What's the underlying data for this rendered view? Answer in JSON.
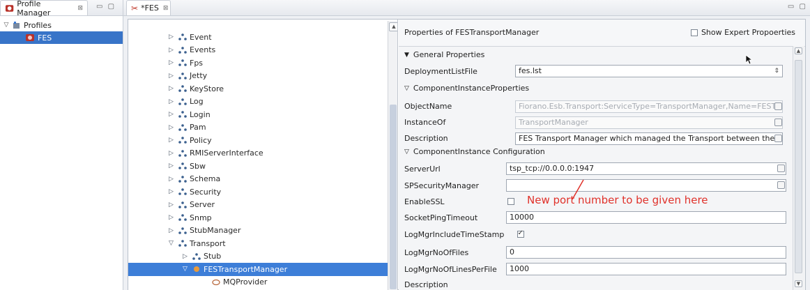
{
  "left_panel": {
    "tab": {
      "title": "Profile Manager",
      "close": "⊠"
    },
    "view_buttons": "▭ ▢",
    "tree": {
      "root": {
        "label": "Profiles",
        "twisty": "▽"
      },
      "child": {
        "label": "FES"
      }
    }
  },
  "editor": {
    "tab": {
      "title": "*FES",
      "close": "⊠"
    },
    "view_buttons": "▭ ▢",
    "tree_items": [
      {
        "label": "Event",
        "twisty": "▷"
      },
      {
        "label": "Events",
        "twisty": "▷"
      },
      {
        "label": "Fps",
        "twisty": "▷"
      },
      {
        "label": "Jetty",
        "twisty": "▷"
      },
      {
        "label": "KeyStore",
        "twisty": "▷"
      },
      {
        "label": "Log",
        "twisty": "▷"
      },
      {
        "label": "Login",
        "twisty": "▷"
      },
      {
        "label": "Pam",
        "twisty": "▷"
      },
      {
        "label": "Policy",
        "twisty": "▷"
      },
      {
        "label": "RMIServerInterface",
        "twisty": "▷"
      },
      {
        "label": "Sbw",
        "twisty": "▷"
      },
      {
        "label": "Schema",
        "twisty": "▷"
      },
      {
        "label": "Security",
        "twisty": "▷"
      },
      {
        "label": "Server",
        "twisty": "▷"
      },
      {
        "label": "Snmp",
        "twisty": "▷"
      },
      {
        "label": "StubManager",
        "twisty": "▷"
      },
      {
        "label": "Transport",
        "twisty": "▽"
      },
      {
        "label": "Stub",
        "twisty": "▷"
      },
      {
        "label": "FESTransportManager",
        "twisty": "▽"
      },
      {
        "label": "MQProvider",
        "twisty": ""
      }
    ]
  },
  "properties": {
    "title": "Properties of FESTransportManager",
    "show_expert_label": "Show Expert Propoerties",
    "sections": {
      "general": "General Properties",
      "instance_props": "ComponentInstanceProperties",
      "instance_config": "ComponentInstance Configuration"
    },
    "rows": {
      "deployment_list_file": {
        "label": "DeploymentListFile",
        "value": "fes.lst"
      },
      "object_name": {
        "label": "ObjectName",
        "value": "Fiorano.Esb.Transport:ServiceType=TransportManager,Name=FESTra"
      },
      "instance_of": {
        "label": "InstanceOf",
        "value": "TransportManager"
      },
      "description": {
        "label": "Description",
        "value": "FES Transport Manager which managed the Transport between the FE"
      },
      "server_url": {
        "label": "ServerUrl",
        "value": "tsp_tcp://0.0.0.0:1947"
      },
      "sp_security_manager": {
        "label": "SPSecurityManager",
        "value": ""
      },
      "enable_ssl": {
        "label": "EnableSSL",
        "checked": false
      },
      "socket_ping_timeout": {
        "label": "SocketPingTimeout",
        "value": "10000"
      },
      "log_mgr_include_timestamp": {
        "label": "LogMgrIncludeTimeStamp",
        "checked": true
      },
      "log_mgr_no_of_files": {
        "label": "LogMgrNoOfFiles",
        "value": "0"
      },
      "log_mgr_no_of_lines": {
        "label": "LogMgrNoOfLinesPerFile",
        "value": "1000"
      }
    },
    "description_footer": "Description",
    "annotation": "New port number to be given here"
  },
  "colors": {
    "selection": "#3d7ed8",
    "annotation": "#e0312a"
  }
}
